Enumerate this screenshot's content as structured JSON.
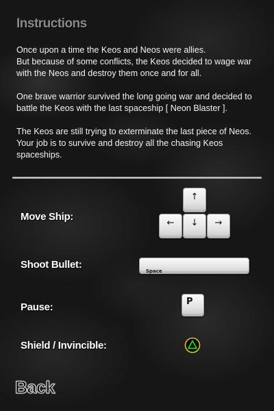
{
  "screen": {
    "title": "Instructions",
    "story": [
      "Once upon a time the Keos and Neos were allies.\nBut because of some conflicts, the Keos decided to wage war with the Neos and destroy them once and for all.",
      "One brave warrior survived the long going war and decided to battle the Keos with the last spaceship [ Neon Blaster ].",
      "The Keos are still trying to exterminate the last piece of Neos. Your job is to survive and destroy all the chasing Keos spaceships."
    ]
  },
  "controls": {
    "move": {
      "label": "Move Ship:",
      "keys": {
        "up": "↑",
        "left": "←",
        "down": "↓",
        "right": "→"
      }
    },
    "shoot": {
      "label": "Shoot Bullet:",
      "key": "Space"
    },
    "pause": {
      "label": "Pause:",
      "key": "P"
    },
    "shield": {
      "label": "Shield / Invincible:",
      "icon": "triangle-button-icon",
      "icon_color": "#2bd12b",
      "ring_color": "#e0c22a"
    }
  },
  "nav": {
    "back_label": "Back"
  }
}
